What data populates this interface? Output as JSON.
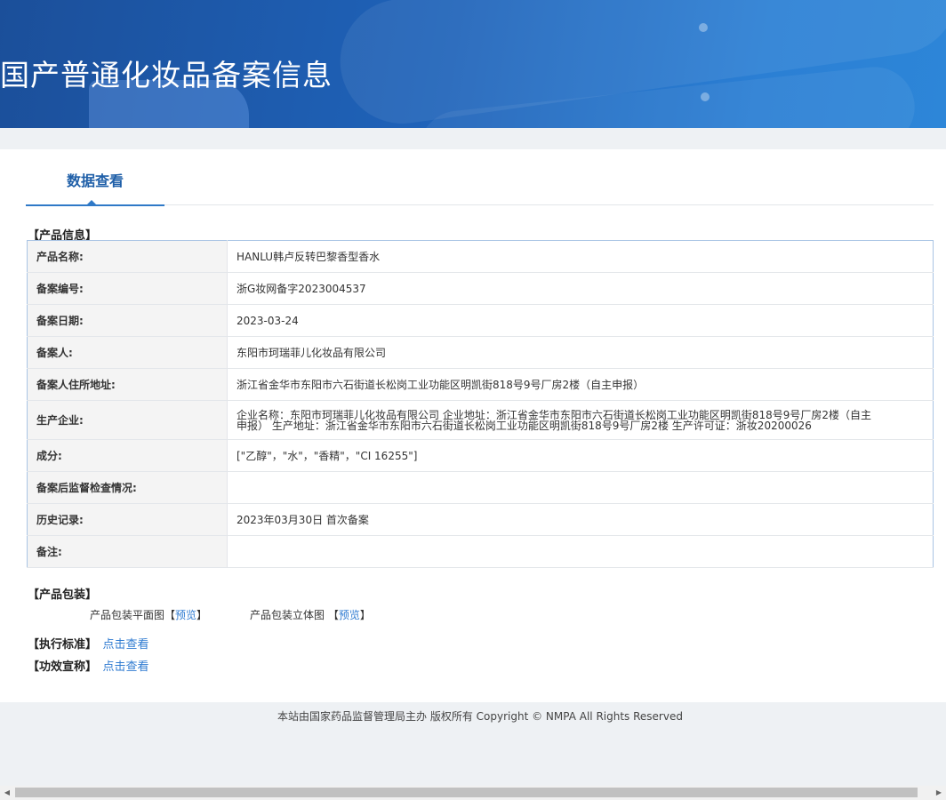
{
  "header": {
    "title": "国产普通化妆品备案信息"
  },
  "tab": {
    "label": "数据查看"
  },
  "product_section_label": "【产品信息】",
  "info_rows": [
    {
      "key": "产品名称:",
      "value": "HANLU韩卢反转巴黎香型香水"
    },
    {
      "key": "备案编号:",
      "value": "浙G妆网备字2023004537"
    },
    {
      "key": "备案日期:",
      "value": "2023-03-24"
    },
    {
      "key": "备案人:",
      "value": "东阳市珂瑞菲儿化妆品有限公司"
    },
    {
      "key": "备案人住所地址:",
      "value": "浙江省金华市东阳市六石街道长松岗工业功能区明凯街818号9号厂房2楼（自主申报）"
    },
    {
      "key": "生产企业:",
      "value": "企业名称：东阳市珂瑞菲儿化妆品有限公司 企业地址：浙江省金华市东阳市六石街道长松岗工业功能区明凯街818号9号厂房2楼（自主申报） 生产地址：浙江省金华市东阳市六石街道长松岗工业功能区明凯街818号9号厂房2楼 生产许可证：浙妆20200026"
    },
    {
      "key": "成分:",
      "value": "[\"乙醇\"，\"水\"，\"香精\"，\"CI 16255\"]"
    },
    {
      "key": "备案后监督检查情况:",
      "value": ""
    },
    {
      "key": "历史记录:",
      "value": "2023年03月30日 首次备案"
    },
    {
      "key": "备注:",
      "value": ""
    }
  ],
  "packaging": {
    "label": "【产品包装】",
    "flat_label": "产品包装平面图【",
    "flat_link": "预览",
    "flat_close": "】",
    "solid_label": "产品包装立体图 【",
    "solid_link": "预览",
    "solid_close": "】"
  },
  "standard": {
    "label": "【执行标准】",
    "link": "点击查看"
  },
  "efficacy": {
    "label": "【功效宣称】",
    "link": "点击查看"
  },
  "footer": {
    "text": "本站由国家药品监督管理局主办 版权所有 Copyright © NMPA All Rights Reserved"
  },
  "colors": {
    "banner": "#1f62b8",
    "accent": "#2f79c7",
    "link": "#2f7bd1"
  }
}
